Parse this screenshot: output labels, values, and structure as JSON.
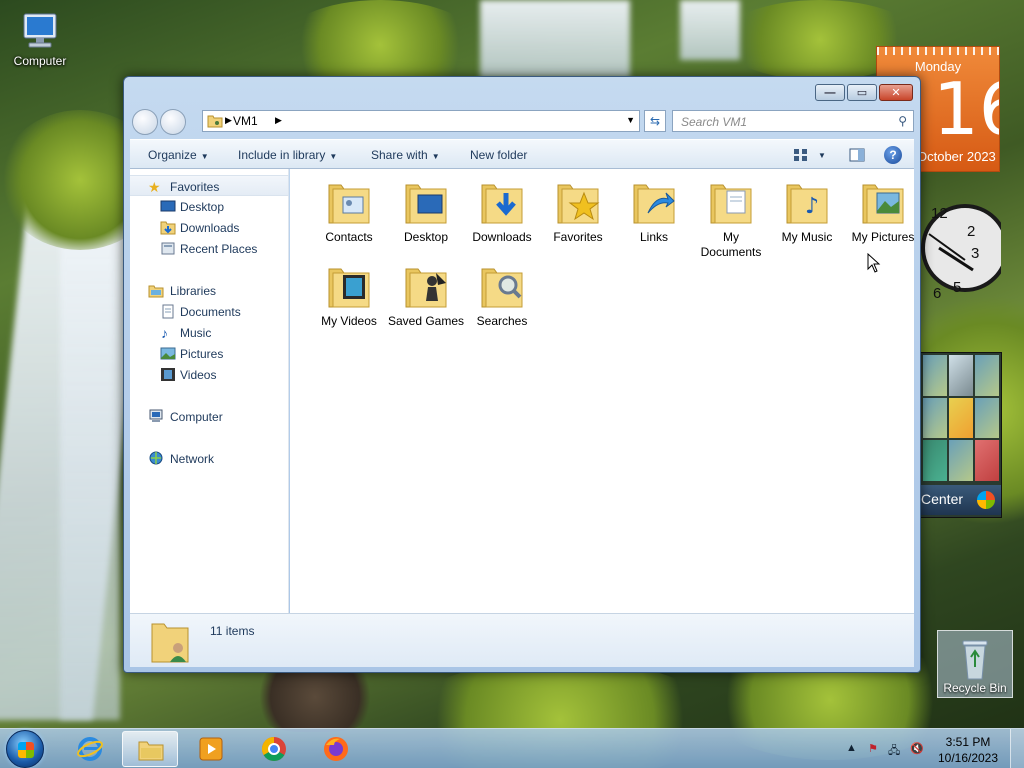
{
  "desktop": {
    "icons": [
      {
        "label": "Computer",
        "icon": "computer-icon"
      },
      {
        "label": "Recycle Bin",
        "icon": "recycle-bin-icon"
      }
    ]
  },
  "gadgets": {
    "calendar": {
      "day_name": "Monday",
      "day_number": "16",
      "month_year": "October 2023"
    },
    "media_center": {
      "label": "Center"
    }
  },
  "window": {
    "address": {
      "crumb": "VM1"
    },
    "search": {
      "placeholder": "Search VM1"
    },
    "toolbar": {
      "organize": "Organize",
      "include_in_library": "Include in library",
      "share_with": "Share with",
      "new_folder": "New folder"
    },
    "nav": {
      "favorites": "Favorites",
      "desktop": "Desktop",
      "downloads": "Downloads",
      "recent_places": "Recent Places",
      "libraries": "Libraries",
      "documents": "Documents",
      "music": "Music",
      "pictures": "Pictures",
      "videos": "Videos",
      "computer": "Computer",
      "network": "Network"
    },
    "folders": [
      {
        "label": "Contacts",
        "icon": "contacts-folder-icon"
      },
      {
        "label": "Desktop",
        "icon": "desktop-folder-icon"
      },
      {
        "label": "Downloads",
        "icon": "downloads-folder-icon"
      },
      {
        "label": "Favorites",
        "icon": "favorites-folder-icon"
      },
      {
        "label": "Links",
        "icon": "links-folder-icon"
      },
      {
        "label": "My Documents",
        "icon": "documents-folder-icon"
      },
      {
        "label": "My Music",
        "icon": "music-folder-icon"
      },
      {
        "label": "My Pictures",
        "icon": "pictures-folder-icon"
      },
      {
        "label": "My Videos",
        "icon": "videos-folder-icon"
      },
      {
        "label": "Saved Games",
        "icon": "saved-games-folder-icon"
      },
      {
        "label": "Searches",
        "icon": "searches-folder-icon"
      }
    ],
    "details": {
      "count": "11 items"
    }
  },
  "taskbar": {
    "apps": [
      {
        "name": "Internet Explorer",
        "icon": "ie-icon"
      },
      {
        "name": "Windows Explorer",
        "icon": "explorer-icon",
        "active": true
      },
      {
        "name": "Windows Media Player",
        "icon": "media-player-icon"
      },
      {
        "name": "Google Chrome",
        "icon": "chrome-icon"
      },
      {
        "name": "Firefox",
        "icon": "firefox-icon"
      }
    ],
    "clock": {
      "time": "3:51 PM",
      "date": "10/16/2023"
    }
  },
  "colors": {
    "accent": "#1e395b",
    "calendar": "#e8742a"
  }
}
